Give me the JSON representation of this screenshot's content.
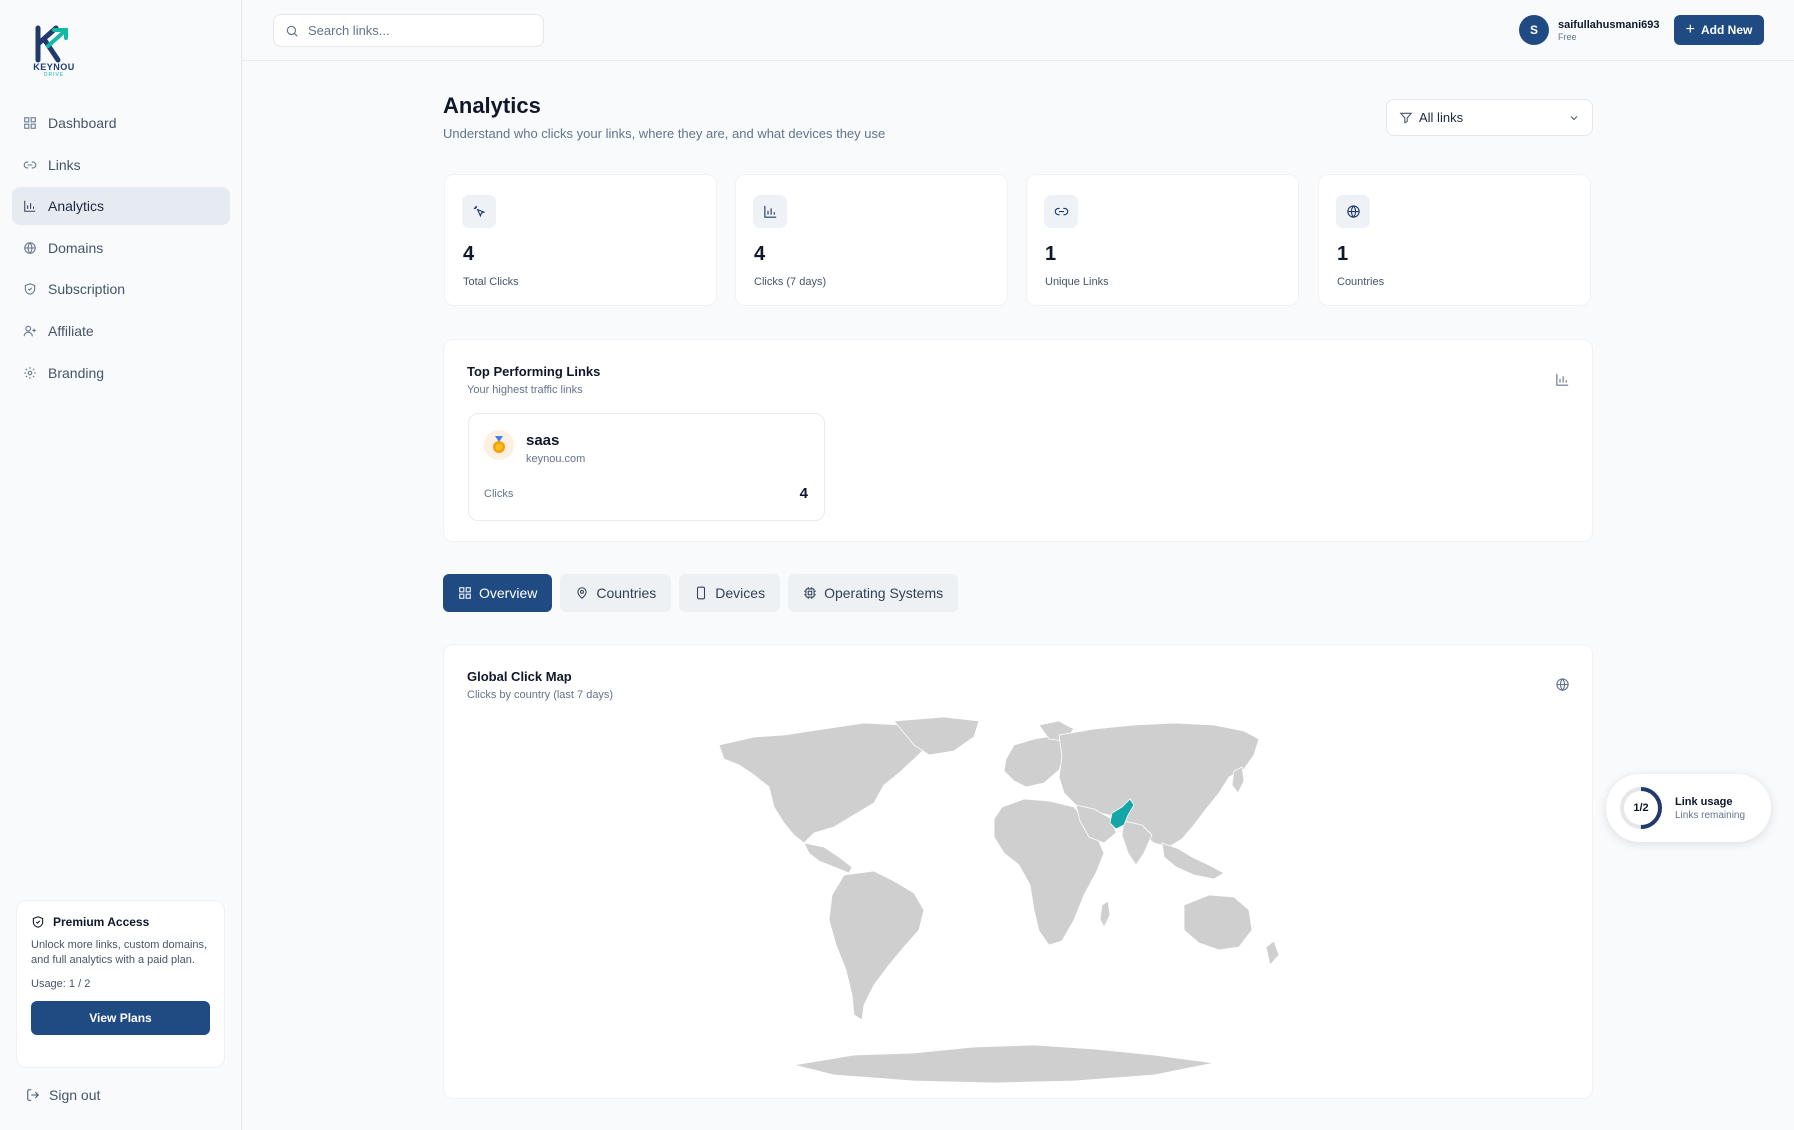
{
  "brand": {
    "logo_text": "KEYNOU",
    "logo_sub": "DRIVE"
  },
  "sidebar": {
    "items": [
      {
        "label": "Dashboard",
        "icon": "grid-icon"
      },
      {
        "label": "Links",
        "icon": "link-icon"
      },
      {
        "label": "Analytics",
        "icon": "bar-chart-icon",
        "active": true
      },
      {
        "label": "Domains",
        "icon": "globe-icon"
      },
      {
        "label": "Subscription",
        "icon": "shield-icon"
      },
      {
        "label": "Affiliate",
        "icon": "user-plus-icon"
      },
      {
        "label": "Branding",
        "icon": "gear-icon"
      }
    ],
    "premium": {
      "title": "Premium Access",
      "description": "Unlock more links, custom domains, and full analytics with a paid plan.",
      "usage": "Usage: 1 / 2",
      "button": "View Plans"
    },
    "signout": "Sign out"
  },
  "topbar": {
    "search_placeholder": "Search links...",
    "user": {
      "initial": "S",
      "name": "saifullahusmani693",
      "plan": "Free"
    },
    "add_button": "Add New"
  },
  "header": {
    "title": "Analytics",
    "subtitle": "Understand who clicks your links, where they are, and what devices they use",
    "filter": "All links"
  },
  "stats": [
    {
      "value": "4",
      "label": "Total Clicks",
      "icon": "cursor-click-icon"
    },
    {
      "value": "4",
      "label": "Clicks (7 days)",
      "icon": "bar-chart-icon"
    },
    {
      "value": "1",
      "label": "Unique Links",
      "icon": "link-icon"
    },
    {
      "value": "1",
      "label": "Countries",
      "icon": "globe-icon"
    }
  ],
  "top_links": {
    "title": "Top Performing Links",
    "subtitle": "Your highest traffic links",
    "links": [
      {
        "name": "saas",
        "domain": "keynou.com",
        "clicks_label": "Clicks",
        "clicks": "4"
      }
    ]
  },
  "tabs": [
    {
      "label": "Overview",
      "icon": "grid-icon",
      "active": true
    },
    {
      "label": "Countries",
      "icon": "map-pin-icon"
    },
    {
      "label": "Devices",
      "icon": "phone-icon"
    },
    {
      "label": "Operating Systems",
      "icon": "cpu-icon"
    }
  ],
  "map": {
    "title": "Global Click Map",
    "subtitle": "Clicks by country (last 7 days)",
    "highlight_color": "#14a6a6",
    "land_color": "#cfcfcf"
  },
  "link_usage": {
    "ring": "1/2",
    "title": "Link usage",
    "subtitle": "Links remaining",
    "fraction": 0.5
  },
  "colors": {
    "primary": "#1f4a82",
    "accent": "#14b8a6"
  }
}
